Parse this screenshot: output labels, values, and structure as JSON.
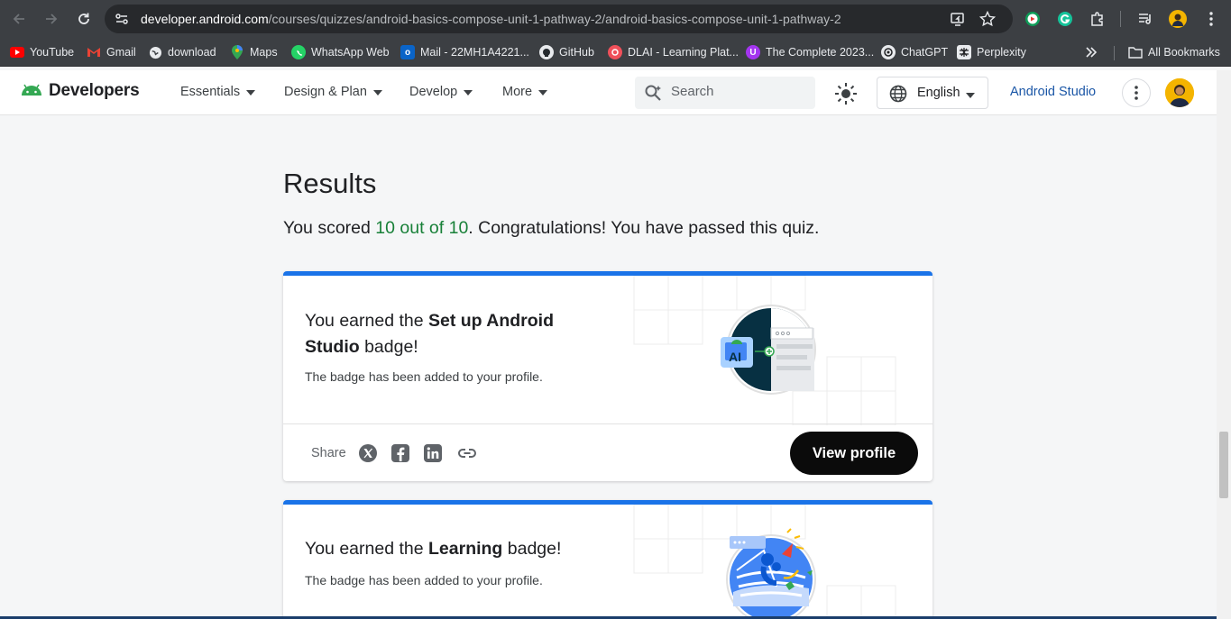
{
  "browser": {
    "url_host": "developer.android.com",
    "url_path": "/courses/quizzes/android-basics-compose-unit-1-pathway-2/android-basics-compose-unit-1-pathway-2"
  },
  "bookmarks": [
    {
      "label": "YouTube",
      "icon": "youtube-icon",
      "color": "#ff0000"
    },
    {
      "label": "Gmail",
      "icon": "gmail-icon",
      "color": "#ea4335"
    },
    {
      "label": "download",
      "icon": "globe-icon",
      "color": "#e8eaed"
    },
    {
      "label": "Maps",
      "icon": "maps-icon",
      "color": "#34a853"
    },
    {
      "label": "WhatsApp Web",
      "icon": "whatsapp-icon",
      "color": "#25d366"
    },
    {
      "label": "Mail - 22MH1A4221...",
      "icon": "outlook-icon",
      "color": "#0a64c8"
    },
    {
      "label": "GitHub",
      "icon": "github-icon",
      "color": "#e8eaed"
    },
    {
      "label": "DLAI - Learning Plat...",
      "icon": "dlai-icon",
      "color": "#f0505a"
    },
    {
      "label": "The Complete 2023...",
      "icon": "udemy-icon",
      "color": "#a435f0"
    },
    {
      "label": "ChatGPT",
      "icon": "chatgpt-icon",
      "color": "#e8eaed"
    },
    {
      "label": "Perplexity",
      "icon": "perplexity-icon",
      "color": "#e8eaed"
    }
  ],
  "all_bookmarks_label": "All Bookmarks",
  "header": {
    "logo_text": "Developers",
    "menus": [
      "Essentials",
      "Design & Plan",
      "Develop",
      "More"
    ],
    "search_placeholder": "Search",
    "language": "English",
    "studio_link": "Android Studio"
  },
  "results": {
    "title": "Results",
    "score_prefix": "You scored ",
    "score_value": "10 out of 10",
    "score_suffix": ". Congratulations! You have passed this quiz."
  },
  "cards": [
    {
      "earned_prefix": "You earned the ",
      "badge_name": "Set up Android Studio",
      "earned_suffix": " badge!",
      "added_text": "The badge has been added to your profile.",
      "share_label": "Share",
      "view_profile_label": "View profile"
    },
    {
      "earned_prefix": "You earned the ",
      "badge_name": "Learning",
      "earned_suffix": " badge!",
      "added_text": "The badge has been added to your profile."
    }
  ],
  "colors": {
    "accent_blue": "#1a73e8",
    "score_green": "#188038",
    "link_blue": "#1a56a6"
  }
}
